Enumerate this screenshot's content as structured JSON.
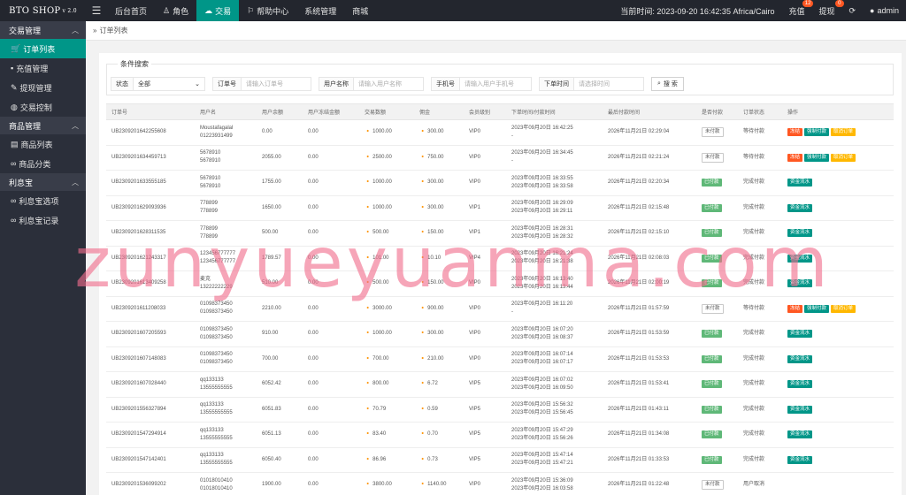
{
  "brand": {
    "name": "BTO SHOP",
    "version": "v 2.0"
  },
  "nav": [
    {
      "icon": "",
      "label": "后台首页"
    },
    {
      "icon": "♙",
      "label": "角色"
    },
    {
      "icon": "☁",
      "label": "交易"
    },
    {
      "icon": "⚐",
      "label": "帮助中心"
    },
    {
      "icon": "",
      "label": "系统管理"
    },
    {
      "icon": "",
      "label": "商城"
    }
  ],
  "topright": {
    "time_label": "当前时间: 2023-09-20 16:42:35  Africa/Cairo",
    "recharge_label": "充值",
    "recharge_badge": "12",
    "withdraw_label": "提现",
    "withdraw_badge": "0",
    "user": "admin"
  },
  "sidebar": {
    "groups": [
      {
        "label": "交易管理",
        "items": [
          {
            "label": "订单列表",
            "active": true
          },
          {
            "label": "充值管理"
          },
          {
            "label": "提现管理"
          },
          {
            "label": "交易控制"
          }
        ]
      },
      {
        "label": "商品管理",
        "items": [
          {
            "label": "商品列表"
          },
          {
            "label": "商品分类"
          }
        ]
      },
      {
        "label": "利息宝",
        "items": [
          {
            "label": "利息宝选项"
          },
          {
            "label": "利息宝记录"
          }
        ]
      }
    ]
  },
  "breadcrumb": "订单列表",
  "search": {
    "legend": "条件搜索",
    "status_label": "状态",
    "status_value": "全部",
    "order_label": "订单号",
    "order_placeholder": "请输入订单号",
    "user_label": "用户名称",
    "user_placeholder": "请输入用户名称",
    "phone_label": "手机号",
    "phone_placeholder": "请输入用户手机号",
    "time_label": "下单时间",
    "time_placeholder": "请选择时间",
    "button": "搜 索"
  },
  "table": {
    "headers": [
      "订单号",
      "用户名",
      "用户余额",
      "用户冻结金额",
      "交易数额",
      "佣金",
      "会员级别",
      "下单时间/付款时间",
      "最后付款时间",
      "是否付款",
      "订单状态",
      "操作"
    ],
    "rows": [
      {
        "order": "UB2309201642255608",
        "user1": "Moustafagalal",
        "user2": "01223931499",
        "balance": "0.00",
        "frozen": "0.00",
        "amount": "1000.00",
        "commission": "300.00",
        "vip": "VIP0",
        "t1": "2023年09月20日 16:42:25",
        "t2": "-",
        "last": "2026年11月21日 02:29:04",
        "paid": "未付款",
        "status": "等待付款",
        "ops": [
          "冻结",
          "强制付款",
          "取消订单"
        ]
      },
      {
        "order": "UB2309201634459713",
        "user1": "5678910",
        "user2": "5678910",
        "balance": "2055.00",
        "frozen": "0.00",
        "amount": "2500.00",
        "commission": "750.00",
        "vip": "VIP0",
        "t1": "2023年09月20日 16:34:45",
        "t2": "-",
        "last": "2026年11月21日 02:21:24",
        "paid": "未付款",
        "status": "等待付款",
        "ops": [
          "冻结",
          "强制付款",
          "取消订单"
        ]
      },
      {
        "order": "UB2309201633555185",
        "user1": "5678910",
        "user2": "5678910",
        "balance": "1755.00",
        "frozen": "0.00",
        "amount": "1000.00",
        "commission": "300.00",
        "vip": "VIP0",
        "t1": "2023年09月20日 16:33:55",
        "t2": "2023年09月20日 16:33:58",
        "last": "2026年11月21日 02:20:34",
        "paid": "已付款",
        "status": "完成付款",
        "ops": [
          "资金流水"
        ]
      },
      {
        "order": "UB2309201629093936",
        "user1": "778899",
        "user2": "778899",
        "balance": "1650.00",
        "frozen": "0.00",
        "amount": "1000.00",
        "commission": "300.00",
        "vip": "VIP1",
        "t1": "2023年09月20日 16:29:09",
        "t2": "2023年09月20日 16:29:11",
        "last": "2026年11月21日 02:15:48",
        "paid": "已付款",
        "status": "完成付款",
        "ops": [
          "资金流水"
        ]
      },
      {
        "order": "UB2309201628311535",
        "user1": "778899",
        "user2": "778899",
        "balance": "500.00",
        "frozen": "0.00",
        "amount": "500.00",
        "commission": "150.00",
        "vip": "VIP1",
        "t1": "2023年09月20日 16:28:31",
        "t2": "2023年09月20日 16:28:32",
        "last": "2026年11月21日 02:15:10",
        "paid": "已付款",
        "status": "完成付款",
        "ops": [
          "资金流水"
        ]
      },
      {
        "order": "UB2309201621243317",
        "user1": "123456777777",
        "user2": "123456777777",
        "balance": "1789.57",
        "frozen": "0.00",
        "amount": "101.00",
        "commission": "10.10",
        "vip": "VIP4",
        "t1": "2023年09月20日 16:21:24",
        "t2": "2023年09月20日 16:21:38",
        "last": "2026年11月21日 02:08:03",
        "paid": "已付款",
        "status": "完成付款",
        "ops": [
          "资金流水"
        ]
      },
      {
        "order": "UB2309201613409258",
        "user1": "麦克",
        "user2": "13222222229",
        "balance": "510.00",
        "frozen": "0.00",
        "amount": "500.00",
        "commission": "150.00",
        "vip": "VIP0",
        "t1": "2023年09月20日 16:13:40",
        "t2": "2023年09月20日 16:13:44",
        "last": "2026年11月21日 02:00:19",
        "paid": "已付款",
        "status": "完成付款",
        "ops": [
          "资金流水"
        ]
      },
      {
        "order": "UB2309201611208033",
        "user1": "01098373450",
        "user2": "01098373450",
        "balance": "2210.00",
        "frozen": "0.00",
        "amount": "3000.00",
        "commission": "900.00",
        "vip": "VIP0",
        "t1": "2023年09月20日 16:11:20",
        "t2": "-",
        "last": "2026年11月21日 01:57:59",
        "paid": "未付款",
        "status": "等待付款",
        "ops": [
          "冻结",
          "强制付款",
          "取消订单"
        ]
      },
      {
        "order": "UB2309201607205593",
        "user1": "01098373450",
        "user2": "01098373450",
        "balance": "910.00",
        "frozen": "0.00",
        "amount": "1000.00",
        "commission": "300.00",
        "vip": "VIP0",
        "t1": "2023年09月20日 16:07:20",
        "t2": "2023年09月20日 16:08:37",
        "last": "2026年11月21日 01:53:59",
        "paid": "已付款",
        "status": "完成付款",
        "ops": [
          "资金流水"
        ]
      },
      {
        "order": "UB2309201607148083",
        "user1": "01098373450",
        "user2": "01098373450",
        "balance": "700.00",
        "frozen": "0.00",
        "amount": "700.00",
        "commission": "210.00",
        "vip": "VIP0",
        "t1": "2023年09月20日 16:07:14",
        "t2": "2023年09月20日 16:07:17",
        "last": "2026年11月21日 01:53:53",
        "paid": "已付款",
        "status": "完成付款",
        "ops": [
          "资金流水"
        ]
      },
      {
        "order": "UB2309201607028440",
        "user1": "qq133133",
        "user2": "13555555555",
        "balance": "6052.42",
        "frozen": "0.00",
        "amount": "800.00",
        "commission": "6.72",
        "vip": "VIP5",
        "t1": "2023年09月20日 16:07:02",
        "t2": "2023年09月20日 16:09:50",
        "last": "2026年11月21日 01:53:41",
        "paid": "已付款",
        "status": "完成付款",
        "ops": [
          "资金流水"
        ]
      },
      {
        "order": "UB2309201556327894",
        "user1": "qq133133",
        "user2": "13555555555",
        "balance": "6051.83",
        "frozen": "0.00",
        "amount": "70.79",
        "commission": "0.59",
        "vip": "VIP5",
        "t1": "2023年09月20日 15:56:32",
        "t2": "2023年09月20日 15:56:45",
        "last": "2026年11月21日 01:43:11",
        "paid": "已付款",
        "status": "完成付款",
        "ops": [
          "资金流水"
        ]
      },
      {
        "order": "UB2309201547294914",
        "user1": "qq133133",
        "user2": "13555555555",
        "balance": "6051.13",
        "frozen": "0.00",
        "amount": "83.40",
        "commission": "0.70",
        "vip": "VIP5",
        "t1": "2023年09月20日 15:47:29",
        "t2": "2023年09月20日 15:56:26",
        "last": "2026年11月21日 01:34:08",
        "paid": "已付款",
        "status": "完成付款",
        "ops": [
          "资金流水"
        ]
      },
      {
        "order": "UB2309201547142401",
        "user1": "qq133133",
        "user2": "13555555555",
        "balance": "6050.40",
        "frozen": "0.00",
        "amount": "86.96",
        "commission": "0.73",
        "vip": "VIP5",
        "t1": "2023年09月20日 15:47:14",
        "t2": "2023年09月20日 15:47:21",
        "last": "2026年11月21日 01:33:53",
        "paid": "已付款",
        "status": "完成付款",
        "ops": [
          "资金流水"
        ]
      },
      {
        "order": "UB2309201536099202",
        "user1": "01018010410",
        "user2": "01018010410",
        "balance": "1900.00",
        "frozen": "0.00",
        "amount": "3800.00",
        "commission": "1140.00",
        "vip": "VIP0",
        "t1": "2023年09月20日 15:36:09",
        "t2": "2023年09月20日 16:03:58",
        "last": "2026年11月21日 01:22:48",
        "paid": "未付款",
        "status": "用户取消",
        "ops": []
      }
    ]
  },
  "watermark": "zunyueyuanma.com",
  "colors": {
    "accent": "#009688",
    "topbar": "#23262e",
    "sidebar": "#2b2f3a",
    "paid": "#5fb878",
    "danger": "#ff5722",
    "warn": "#ffb800"
  }
}
